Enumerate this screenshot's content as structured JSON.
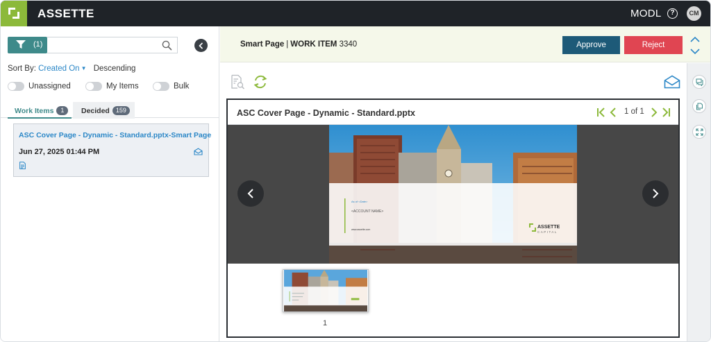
{
  "app": {
    "brand": "ASSETTE",
    "org": "MODL",
    "user_initials": "CM",
    "colors": {
      "brand_green": "#8cb93a",
      "teal": "#3e8a8a",
      "link_blue": "#2b87c7",
      "approve": "#1d5a78",
      "reject": "#e04552"
    }
  },
  "left": {
    "filter_count": "(1)",
    "search_placeholder": "",
    "sort_label": "Sort By:",
    "sort_field": "Created On",
    "sort_order": "Descending",
    "toggles": [
      {
        "label": "Unassigned",
        "on": false
      },
      {
        "label": "My Items",
        "on": false
      },
      {
        "label": "Bulk",
        "on": false
      }
    ],
    "tabs": [
      {
        "label": "Work Items",
        "count": "1",
        "active": true
      },
      {
        "label": "Decided",
        "count": "159",
        "active": false
      }
    ],
    "items": [
      {
        "title": "ASC Cover Page - Dynamic - Standard.pptx-Smart Page",
        "date": "Jun 27, 2025 01:44 PM"
      }
    ]
  },
  "header": {
    "page_type": "Smart Page",
    "separator": "|",
    "work_item_label": "WORK ITEM",
    "work_item_id": "3340",
    "approve_label": "Approve",
    "reject_label": "Reject"
  },
  "viewer": {
    "title": "ASC Cover Page - Dynamic - Standard.pptx",
    "page_text": "1 of 1",
    "slide": {
      "as_of": "As of <Date>",
      "account": "<ACCOUNT NAME>",
      "website": "www.assette.com",
      "logo_line1": "ASSETTE",
      "logo_line2": "CAPITAL"
    },
    "thumbnail_number": "1"
  }
}
